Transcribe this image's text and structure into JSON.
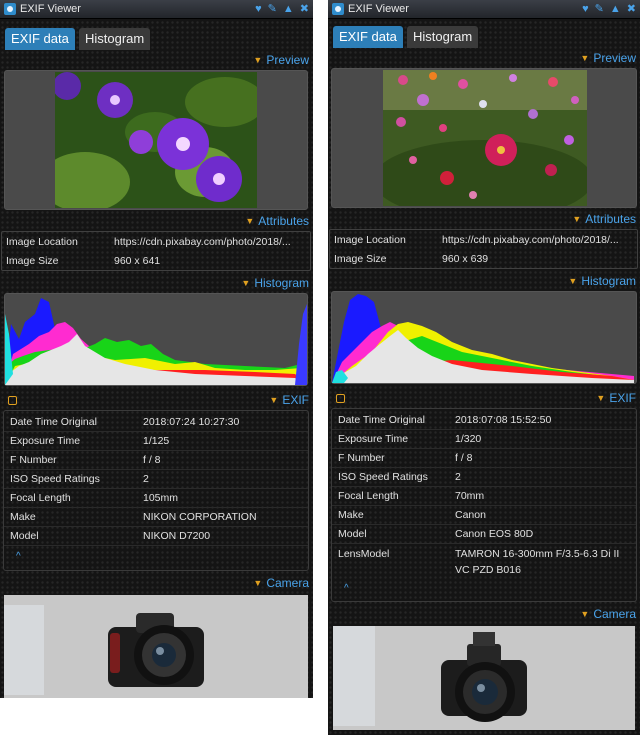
{
  "app": {
    "title": "EXIF Viewer"
  },
  "tabs": {
    "exif": "EXIF data",
    "histogram": "Histogram"
  },
  "sections": {
    "preview": "Preview",
    "attributes": "Attributes",
    "histogram": "Histogram",
    "exif": "EXIF",
    "camera": "Camera"
  },
  "icons": [
    "heart-icon",
    "wrench-icon",
    "warning-icon",
    "close-icon"
  ],
  "colors": {
    "accent": "#4aa3ea",
    "tab_active": "#2d7fb8",
    "arrow": "#e0a020"
  },
  "left": {
    "attributes": [
      {
        "label": "Image Location",
        "value": "https://cdn.pixabay.com/photo/2018/..."
      },
      {
        "label": "Image Size",
        "value": "960 x 641"
      }
    ],
    "exif": [
      {
        "label": "Date Time Original",
        "value": "2018:07:24 10:27:30"
      },
      {
        "label": "Exposure Time",
        "value": "1/125"
      },
      {
        "label": "F Number",
        "value": "f / 8"
      },
      {
        "label": "ISO Speed Ratings",
        "value": "2"
      },
      {
        "label": "Focal Length",
        "value": "105mm"
      },
      {
        "label": "Make",
        "value": "NIKON CORPORATION"
      },
      {
        "label": "Model",
        "value": "NIKON D7200"
      }
    ]
  },
  "right": {
    "attributes": [
      {
        "label": "Image Location",
        "value": "https://cdn.pixabay.com/photo/2018/..."
      },
      {
        "label": "Image Size",
        "value": "960 x 639"
      }
    ],
    "exif": [
      {
        "label": "Date Time Original",
        "value": "2018:07:08 15:52:50"
      },
      {
        "label": "Exposure Time",
        "value": "1/320"
      },
      {
        "label": "F Number",
        "value": "f / 8"
      },
      {
        "label": "ISO Speed Ratings",
        "value": "2"
      },
      {
        "label": "Focal Length",
        "value": "70mm"
      },
      {
        "label": "Make",
        "value": "Canon"
      },
      {
        "label": "Model",
        "value": "Canon EOS 80D"
      },
      {
        "label": "LensModel",
        "value": "TAMRON 16-300mm F/3.5-6.3 Di II VC PZD B016"
      }
    ]
  }
}
